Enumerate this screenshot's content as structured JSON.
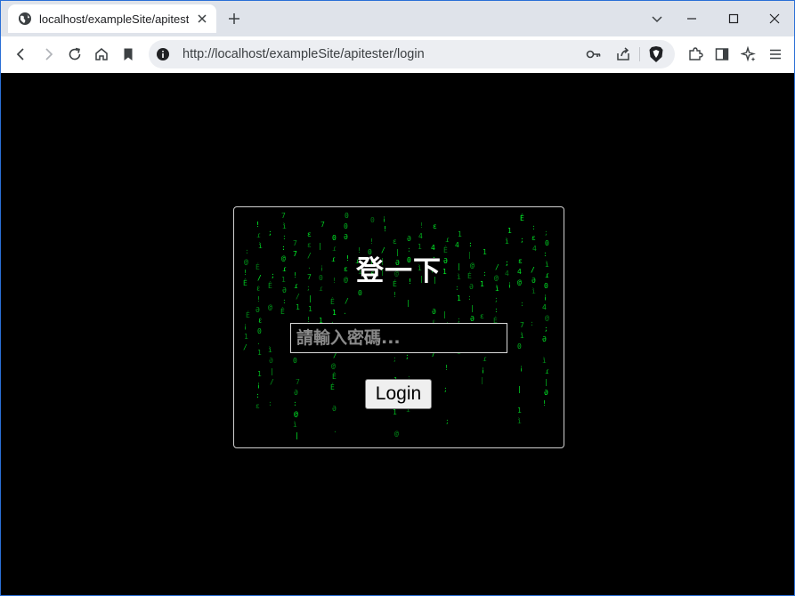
{
  "browser": {
    "tab_title": "localhost/exampleSite/apitester/login",
    "url": "http://localhost/exampleSite/apitester/login",
    "accent_color": "#2a6fd6"
  },
  "icons": {
    "tab_favicon": "globe-icon",
    "tab_close": "close-icon",
    "new_tab": "plus-icon",
    "tab_search": "chevron-down-icon",
    "minimize": "minimize-icon",
    "maximize": "maximize-icon",
    "close_window": "close-icon",
    "back": "back-arrow-icon",
    "forward": "forward-arrow-icon",
    "reload": "reload-icon",
    "home": "home-icon",
    "bookmark": "bookmark-icon",
    "site_info": "info-icon",
    "password_key": "key-icon",
    "share": "share-icon",
    "brave_shields": "brave-lion-icon",
    "extensions": "puzzle-icon",
    "sidebar": "sidebar-icon",
    "leo_ai": "sparkle-icon",
    "menu": "hamburger-menu-icon"
  },
  "login": {
    "title": "登一下",
    "password_placeholder": "請輸入密碼...",
    "password_value": "",
    "button_label": "Login",
    "rain_color": "#00ff2a"
  }
}
